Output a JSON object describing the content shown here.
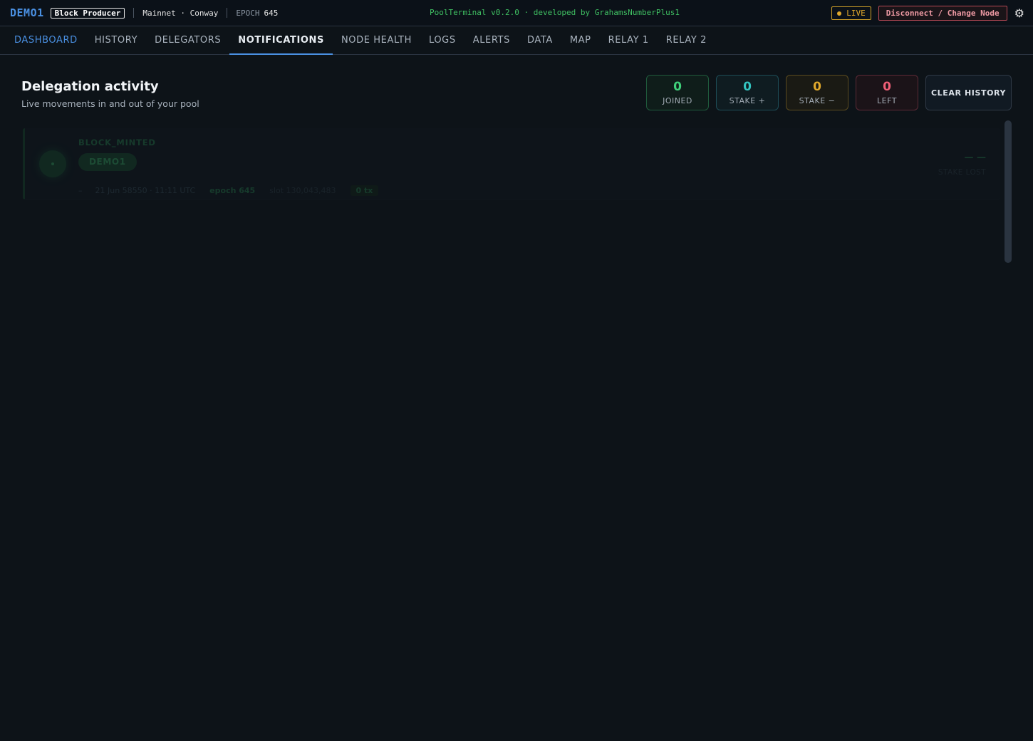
{
  "topbar": {
    "pool_name": "DEMO1",
    "role": "Block Producer",
    "network": "Mainnet · Conway",
    "epoch_label": "EPOCH",
    "epoch_value": "645",
    "app_title": "PoolTerminal v0.2.0 · developed by GrahamsNumberPlus1",
    "live_label": "LIVE",
    "disconnect_label": "Disconnect / Change Node",
    "settings_icon": "gear-icon"
  },
  "nav": {
    "items": [
      {
        "label": "DASHBOARD"
      },
      {
        "label": "HISTORY"
      },
      {
        "label": "DELEGATORS"
      },
      {
        "label": "NOTIFICATIONS"
      },
      {
        "label": "NODE HEALTH"
      },
      {
        "label": "LOGS"
      },
      {
        "label": "ALERTS"
      },
      {
        "label": "DATA"
      },
      {
        "label": "MAP"
      },
      {
        "label": "RELAY 1"
      },
      {
        "label": "RELAY 2"
      }
    ],
    "active": "NOTIFICATIONS"
  },
  "section": {
    "title": "Delegation activity",
    "subtitle": "Live movements in and out of your pool"
  },
  "stats": {
    "joined": {
      "value": "0",
      "label": "JOINED",
      "color": "#3fd07a"
    },
    "stake_plus": {
      "value": "0",
      "label": "STAKE +",
      "color": "#33c4c0"
    },
    "stake_minus": {
      "value": "0",
      "label": "STAKE −",
      "color": "#e0a82c"
    },
    "left": {
      "value": "0",
      "label": "LEFT",
      "color": "#ef5f76"
    },
    "clear_label": "CLEAR HISTORY"
  },
  "events": [
    {
      "type": "BLOCK_MINTED",
      "pool": "DEMO1",
      "dash": "–",
      "date": "21 Jun 58550 · 11:11 UTC",
      "epoch": "epoch 645",
      "slot": "slot 130,043,483",
      "tx": "0 tx",
      "amount": "— —",
      "amount_label": "STAKE LOST"
    }
  ]
}
